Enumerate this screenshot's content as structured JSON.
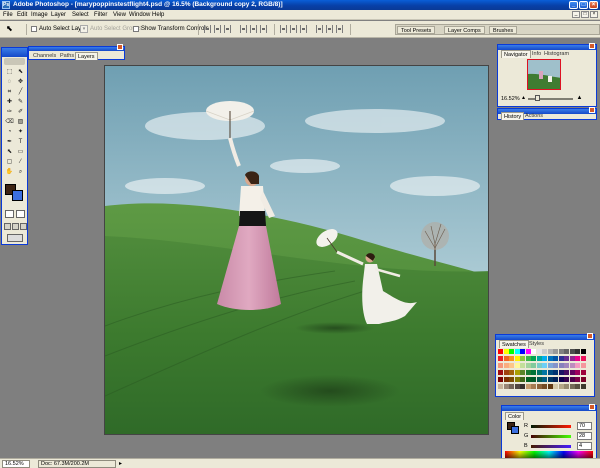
{
  "window": {
    "title": "Adobe Photoshop - [marypoppinstestflight4.psd @ 16.5% (Background copy 2, RGB/8)]",
    "logo_text": "Ps",
    "minimize_glyph": "_",
    "maximize_glyph": "□",
    "close_glyph": "×"
  },
  "menu": {
    "items": [
      "File",
      "Edit",
      "Image",
      "Layer",
      "Select",
      "Filter",
      "View",
      "Window",
      "Help"
    ],
    "doc_buttons": [
      "_",
      "□",
      "×"
    ]
  },
  "options": {
    "tool_icon": "move-tool-icon",
    "tool_glyph": "⬉",
    "auto_select_layer": "Auto Select Layer",
    "auto_select_groups": "Auto Select Groups",
    "show_transform_controls": "Show Transform Controls",
    "palette_well_tabs": [
      "Tool Presets",
      "Layer Comps",
      "Brushes"
    ]
  },
  "tools": {
    "glyphs": [
      "⬚",
      "⬉",
      "◌",
      "✥",
      "⌗",
      "╱",
      "✚",
      "✎",
      "✑",
      "✐",
      "⌫",
      "▨",
      "◔",
      "✦",
      "✒",
      "T",
      "⬉",
      "▭",
      "▢",
      "⁄",
      "✋",
      "⌕"
    ]
  },
  "layers_palette": {
    "tabs": [
      "Channels",
      "Paths",
      "Layers"
    ],
    "active_tab": "Layers"
  },
  "navigator_palette": {
    "tabs": [
      "Navigator",
      "Info",
      "Histogram"
    ],
    "active_tab": "Navigator",
    "zoom": "16.52%",
    "zoom_level": 0.2
  },
  "history_palette": {
    "tabs": [
      "History",
      "Actions"
    ],
    "active_tab": "History"
  },
  "swatches_palette": {
    "tabs": [
      "Swatches",
      "Styles"
    ],
    "active_tab": "Swatches",
    "colors": [
      "#ff0000",
      "#ffff00",
      "#00ff00",
      "#00ffff",
      "#0000ff",
      "#ff00ff",
      "#ffffff",
      "#e6e6e6",
      "#cccccc",
      "#b3b3b3",
      "#999999",
      "#808080",
      "#666666",
      "#4d4d4d",
      "#333333",
      "#000000",
      "#ee1d24",
      "#f26522",
      "#f7941d",
      "#fff200",
      "#8dc63f",
      "#39b54a",
      "#00a651",
      "#00a99d",
      "#00aeef",
      "#0072bc",
      "#0054a6",
      "#2e3192",
      "#662d91",
      "#92278f",
      "#ec008c",
      "#ed145b",
      "#f69679",
      "#f9ad81",
      "#fdc689",
      "#fff799",
      "#c4df9b",
      "#a3d39c",
      "#82ca9c",
      "#7accc8",
      "#6dcff6",
      "#7da7d9",
      "#8393ca",
      "#8781bd",
      "#a187be",
      "#bd8cbf",
      "#f49ac1",
      "#f5989d",
      "#9e0b0f",
      "#a0410d",
      "#a36209",
      "#aba000",
      "#598527",
      "#1a7b30",
      "#007236",
      "#00746b",
      "#0076a3",
      "#004b80",
      "#003471",
      "#1b1464",
      "#440e62",
      "#630460",
      "#9e005d",
      "#9e0039",
      "#790000",
      "#7b2e00",
      "#7d4900",
      "#827b00",
      "#406618",
      "#005e20",
      "#005826",
      "#005952",
      "#005b7f",
      "#003663",
      "#002157",
      "#0d004c",
      "#32004b",
      "#4b0049",
      "#7b0046",
      "#7a0026",
      "#c7b299",
      "#998675",
      "#736357",
      "#534741",
      "#37302d",
      "#c69c6d",
      "#a67c52",
      "#8c6239",
      "#754c24",
      "#603913",
      "#d4c9a8",
      "#b5a888",
      "#958a70",
      "#756c58",
      "#595142",
      "#3d3a2c"
    ]
  },
  "color_palette": {
    "tabs": [
      "Color",
      "Swatches"
    ],
    "active_tab": "Color",
    "channels": [
      {
        "label": "R",
        "value": "70"
      },
      {
        "label": "G",
        "value": "28"
      },
      {
        "label": "B",
        "value": "4"
      }
    ],
    "foreground": "#3d2312",
    "background": "#3b6fe0"
  },
  "status": {
    "zoom": "16.52%",
    "doc": "Doc: 67.3M/200.2M"
  }
}
